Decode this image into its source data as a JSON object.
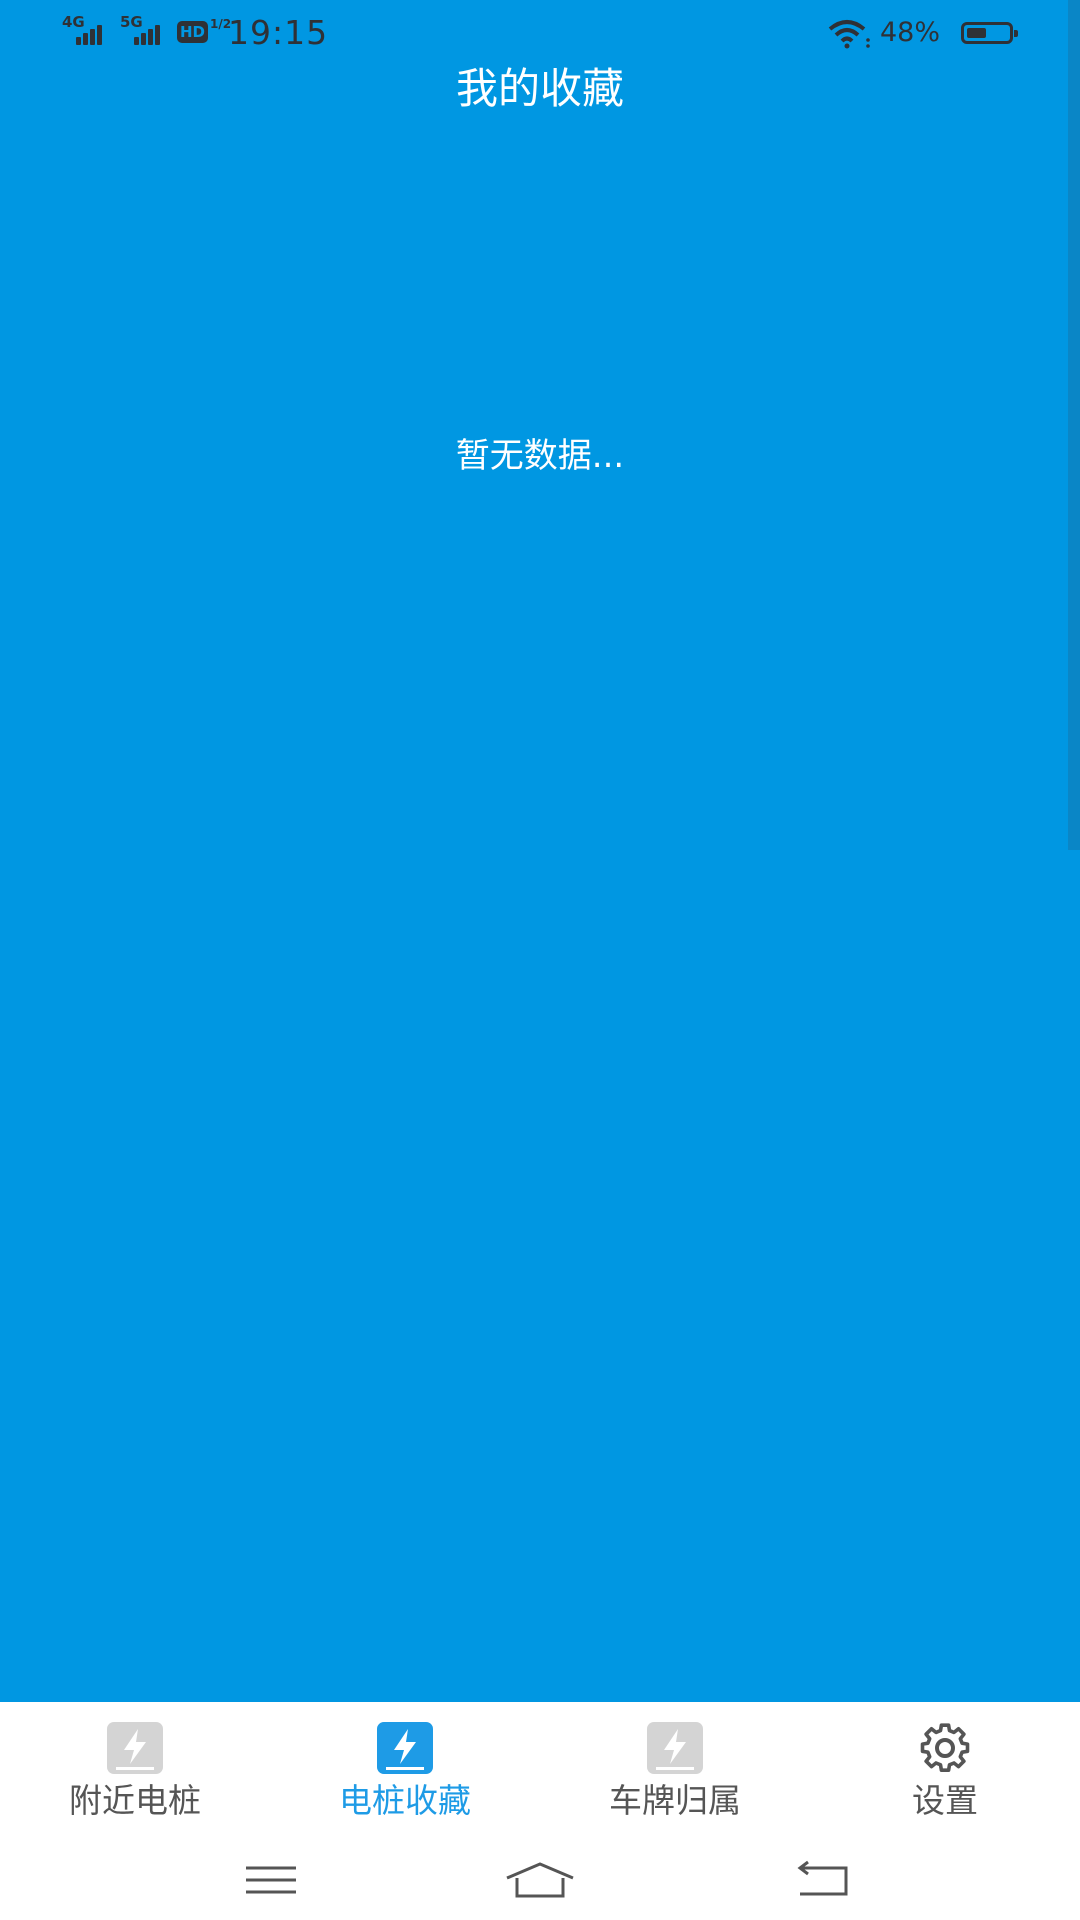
{
  "status_bar": {
    "network_1": "4G",
    "network_2": "5G",
    "hd_label": "HD",
    "hd_fraction": "1/2",
    "time": "19:15",
    "battery_percent": "48%",
    "battery_level": 0.48,
    "icons": [
      "signal-icon",
      "signal-icon",
      "hd-icon",
      "wifi-icon",
      "battery-icon"
    ]
  },
  "header": {
    "title": "我的收藏"
  },
  "main": {
    "empty_message": "暂无数据..."
  },
  "tabbar": {
    "tabs": [
      {
        "label": "附近电桩",
        "icon": "charging-bolt-icon",
        "active": false
      },
      {
        "label": "电桩收藏",
        "icon": "charging-bolt-icon",
        "active": true
      },
      {
        "label": "车牌归属",
        "icon": "charging-bolt-icon",
        "active": false
      },
      {
        "label": "设置",
        "icon": "gear-icon",
        "active": false
      }
    ]
  },
  "system_nav": {
    "buttons": [
      "menu-icon",
      "home-icon",
      "back-icon"
    ]
  },
  "colors": {
    "background": "#0097e2",
    "tab_active": "#1e9be6",
    "tab_inactive_icon": "#d4d4d4",
    "tab_inactive_text": "#555555"
  }
}
